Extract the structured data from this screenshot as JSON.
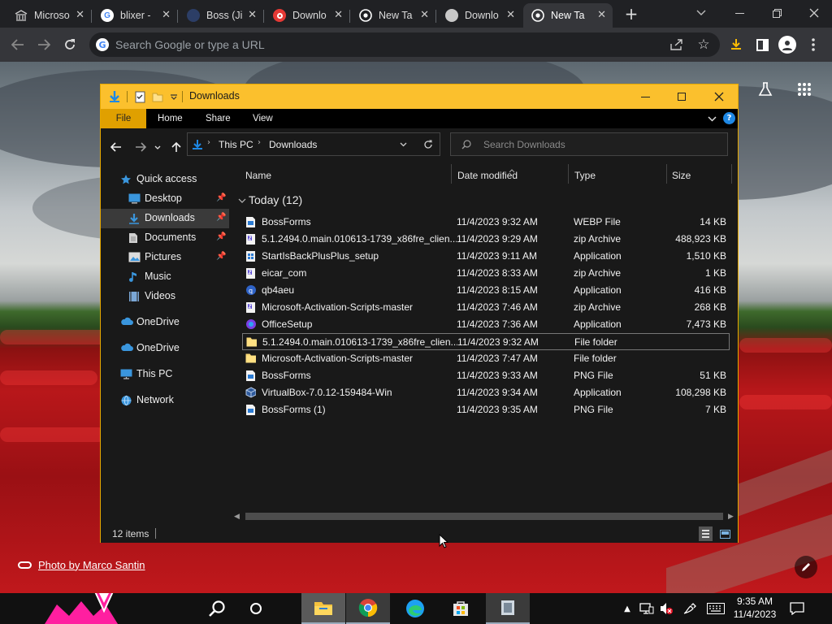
{
  "browser": {
    "tabs": [
      {
        "title": "Microso",
        "icon": "microsoft-building-icon",
        "active": false
      },
      {
        "title": "blixer - ",
        "icon": "google-g-icon",
        "active": false
      },
      {
        "title": "Boss (Ji",
        "icon": "jira-app-icon",
        "active": false
      },
      {
        "title": "Downlo",
        "icon": "opera-download-icon",
        "active": false
      },
      {
        "title": "New Ta",
        "icon": "chrome-icon",
        "active": false
      },
      {
        "title": "Downlo",
        "icon": "globe-icon",
        "active": false
      },
      {
        "title": "New Ta",
        "icon": "chrome-icon",
        "active": true
      }
    ],
    "new_tab_symbol": "+",
    "omnibox_placeholder": "Search Google or type a URL"
  },
  "newtab": {
    "photo_credit": "Photo by Marco Santin"
  },
  "explorer": {
    "title": "Downloads",
    "ribbon_tabs": [
      "File",
      "Home",
      "Share",
      "View"
    ],
    "help_symbol": "?",
    "breadcrumb": [
      "This PC",
      "Downloads"
    ],
    "search_placeholder": "Search Downloads",
    "sidebar": [
      {
        "label": "Quick access",
        "icon": "star-icon",
        "level": 0,
        "pinned": false,
        "selected": false
      },
      {
        "label": "Desktop",
        "icon": "desktop-icon",
        "level": 1,
        "pinned": true,
        "selected": false
      },
      {
        "label": "Downloads",
        "icon": "download-arrow-icon",
        "level": 1,
        "pinned": true,
        "selected": true
      },
      {
        "label": "Documents",
        "icon": "documents-icon",
        "level": 1,
        "pinned": true,
        "selected": false
      },
      {
        "label": "Pictures",
        "icon": "pictures-icon",
        "level": 1,
        "pinned": true,
        "selected": false
      },
      {
        "label": "Music",
        "icon": "music-note-icon",
        "level": 1,
        "pinned": false,
        "selected": false
      },
      {
        "label": "Videos",
        "icon": "film-icon",
        "level": 1,
        "pinned": false,
        "selected": false
      },
      {
        "label": "OneDrive",
        "icon": "cloud-icon",
        "level": 0,
        "pinned": false,
        "selected": false
      },
      {
        "label": "OneDrive",
        "icon": "cloud-icon",
        "level": 0,
        "pinned": false,
        "selected": false
      },
      {
        "label": "This PC",
        "icon": "computer-icon",
        "level": 0,
        "pinned": false,
        "selected": false
      },
      {
        "label": "Network",
        "icon": "network-icon",
        "level": 0,
        "pinned": false,
        "selected": false
      }
    ],
    "columns": [
      "Name",
      "Date modified",
      "Type",
      "Size"
    ],
    "group_label": "Today (12)",
    "files": [
      {
        "name": "BossForms",
        "date": "11/4/2023 9:32 AM",
        "type": "WEBP File",
        "size": "14 KB",
        "icon": "image-file-icon"
      },
      {
        "name": "5.1.2494.0.main.010613-1739_x86fre_clien...",
        "date": "11/4/2023 9:29 AM",
        "type": "zip Archive",
        "size": "488,923 KB",
        "icon": "zip-archive-icon"
      },
      {
        "name": "StartIsBackPlusPlus_setup",
        "date": "11/4/2023 9:11 AM",
        "type": "Application",
        "size": "1,510 KB",
        "icon": "setup-app-icon"
      },
      {
        "name": "eicar_com",
        "date": "11/4/2023 8:33 AM",
        "type": "zip Archive",
        "size": "1 KB",
        "icon": "zip-archive-icon"
      },
      {
        "name": "qb4aeu",
        "date": "11/4/2023 8:15 AM",
        "type": "Application",
        "size": "416 KB",
        "icon": "qbittorrent-icon"
      },
      {
        "name": "Microsoft-Activation-Scripts-master",
        "date": "11/4/2023 7:46 AM",
        "type": "zip Archive",
        "size": "268 KB",
        "icon": "zip-archive-icon"
      },
      {
        "name": "OfficeSetup",
        "date": "11/4/2023 7:36 AM",
        "type": "Application",
        "size": "7,473 KB",
        "icon": "office-icon"
      },
      {
        "name": "5.1.2494.0.main.010613-1739_x86fre_clien...",
        "date": "11/4/2023 9:32 AM",
        "type": "File folder",
        "size": "",
        "icon": "folder-icon",
        "selected": true
      },
      {
        "name": "Microsoft-Activation-Scripts-master",
        "date": "11/4/2023 7:47 AM",
        "type": "File folder",
        "size": "",
        "icon": "folder-icon"
      },
      {
        "name": "BossForms",
        "date": "11/4/2023 9:33 AM",
        "type": "PNG File",
        "size": "51 KB",
        "icon": "image-file-icon"
      },
      {
        "name": "VirtualBox-7.0.12-159484-Win",
        "date": "11/4/2023 9:34 AM",
        "type": "Application",
        "size": "108,298 KB",
        "icon": "virtualbox-icon"
      },
      {
        "name": "BossForms (1)",
        "date": "11/4/2023 9:35 AM",
        "type": "PNG File",
        "size": "7 KB",
        "icon": "image-file-icon"
      }
    ],
    "status_text": "12 items"
  },
  "taskbar": {
    "time": "9:35 AM",
    "date": "11/4/2023"
  },
  "colors": {
    "explorer_titlebar": "#fbc02d",
    "ribbon_file_tab": "#e0a000",
    "chrome_frame": "#202124",
    "chrome_toolbar": "#35363a",
    "download_blue": "#1e88e5"
  }
}
